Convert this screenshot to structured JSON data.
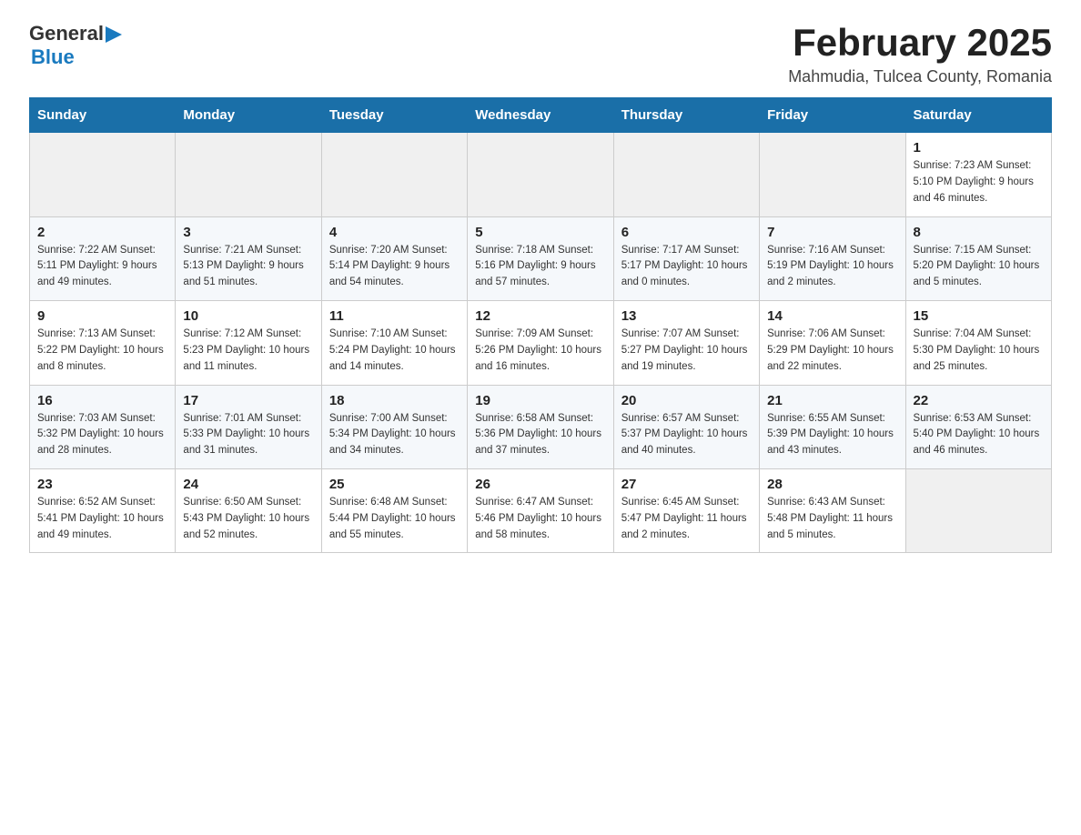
{
  "header": {
    "logo_general": "General",
    "logo_blue": "Blue",
    "month_title": "February 2025",
    "location": "Mahmudia, Tulcea County, Romania"
  },
  "days_of_week": [
    "Sunday",
    "Monday",
    "Tuesday",
    "Wednesday",
    "Thursday",
    "Friday",
    "Saturday"
  ],
  "weeks": [
    {
      "cells": [
        {
          "day": "",
          "info": ""
        },
        {
          "day": "",
          "info": ""
        },
        {
          "day": "",
          "info": ""
        },
        {
          "day": "",
          "info": ""
        },
        {
          "day": "",
          "info": ""
        },
        {
          "day": "",
          "info": ""
        },
        {
          "day": "1",
          "info": "Sunrise: 7:23 AM\nSunset: 5:10 PM\nDaylight: 9 hours and 46 minutes."
        }
      ]
    },
    {
      "cells": [
        {
          "day": "2",
          "info": "Sunrise: 7:22 AM\nSunset: 5:11 PM\nDaylight: 9 hours and 49 minutes."
        },
        {
          "day": "3",
          "info": "Sunrise: 7:21 AM\nSunset: 5:13 PM\nDaylight: 9 hours and 51 minutes."
        },
        {
          "day": "4",
          "info": "Sunrise: 7:20 AM\nSunset: 5:14 PM\nDaylight: 9 hours and 54 minutes."
        },
        {
          "day": "5",
          "info": "Sunrise: 7:18 AM\nSunset: 5:16 PM\nDaylight: 9 hours and 57 minutes."
        },
        {
          "day": "6",
          "info": "Sunrise: 7:17 AM\nSunset: 5:17 PM\nDaylight: 10 hours and 0 minutes."
        },
        {
          "day": "7",
          "info": "Sunrise: 7:16 AM\nSunset: 5:19 PM\nDaylight: 10 hours and 2 minutes."
        },
        {
          "day": "8",
          "info": "Sunrise: 7:15 AM\nSunset: 5:20 PM\nDaylight: 10 hours and 5 minutes."
        }
      ]
    },
    {
      "cells": [
        {
          "day": "9",
          "info": "Sunrise: 7:13 AM\nSunset: 5:22 PM\nDaylight: 10 hours and 8 minutes."
        },
        {
          "day": "10",
          "info": "Sunrise: 7:12 AM\nSunset: 5:23 PM\nDaylight: 10 hours and 11 minutes."
        },
        {
          "day": "11",
          "info": "Sunrise: 7:10 AM\nSunset: 5:24 PM\nDaylight: 10 hours and 14 minutes."
        },
        {
          "day": "12",
          "info": "Sunrise: 7:09 AM\nSunset: 5:26 PM\nDaylight: 10 hours and 16 minutes."
        },
        {
          "day": "13",
          "info": "Sunrise: 7:07 AM\nSunset: 5:27 PM\nDaylight: 10 hours and 19 minutes."
        },
        {
          "day": "14",
          "info": "Sunrise: 7:06 AM\nSunset: 5:29 PM\nDaylight: 10 hours and 22 minutes."
        },
        {
          "day": "15",
          "info": "Sunrise: 7:04 AM\nSunset: 5:30 PM\nDaylight: 10 hours and 25 minutes."
        }
      ]
    },
    {
      "cells": [
        {
          "day": "16",
          "info": "Sunrise: 7:03 AM\nSunset: 5:32 PM\nDaylight: 10 hours and 28 minutes."
        },
        {
          "day": "17",
          "info": "Sunrise: 7:01 AM\nSunset: 5:33 PM\nDaylight: 10 hours and 31 minutes."
        },
        {
          "day": "18",
          "info": "Sunrise: 7:00 AM\nSunset: 5:34 PM\nDaylight: 10 hours and 34 minutes."
        },
        {
          "day": "19",
          "info": "Sunrise: 6:58 AM\nSunset: 5:36 PM\nDaylight: 10 hours and 37 minutes."
        },
        {
          "day": "20",
          "info": "Sunrise: 6:57 AM\nSunset: 5:37 PM\nDaylight: 10 hours and 40 minutes."
        },
        {
          "day": "21",
          "info": "Sunrise: 6:55 AM\nSunset: 5:39 PM\nDaylight: 10 hours and 43 minutes."
        },
        {
          "day": "22",
          "info": "Sunrise: 6:53 AM\nSunset: 5:40 PM\nDaylight: 10 hours and 46 minutes."
        }
      ]
    },
    {
      "cells": [
        {
          "day": "23",
          "info": "Sunrise: 6:52 AM\nSunset: 5:41 PM\nDaylight: 10 hours and 49 minutes."
        },
        {
          "day": "24",
          "info": "Sunrise: 6:50 AM\nSunset: 5:43 PM\nDaylight: 10 hours and 52 minutes."
        },
        {
          "day": "25",
          "info": "Sunrise: 6:48 AM\nSunset: 5:44 PM\nDaylight: 10 hours and 55 minutes."
        },
        {
          "day": "26",
          "info": "Sunrise: 6:47 AM\nSunset: 5:46 PM\nDaylight: 10 hours and 58 minutes."
        },
        {
          "day": "27",
          "info": "Sunrise: 6:45 AM\nSunset: 5:47 PM\nDaylight: 11 hours and 2 minutes."
        },
        {
          "day": "28",
          "info": "Sunrise: 6:43 AM\nSunset: 5:48 PM\nDaylight: 11 hours and 5 minutes."
        },
        {
          "day": "",
          "info": ""
        }
      ]
    }
  ]
}
